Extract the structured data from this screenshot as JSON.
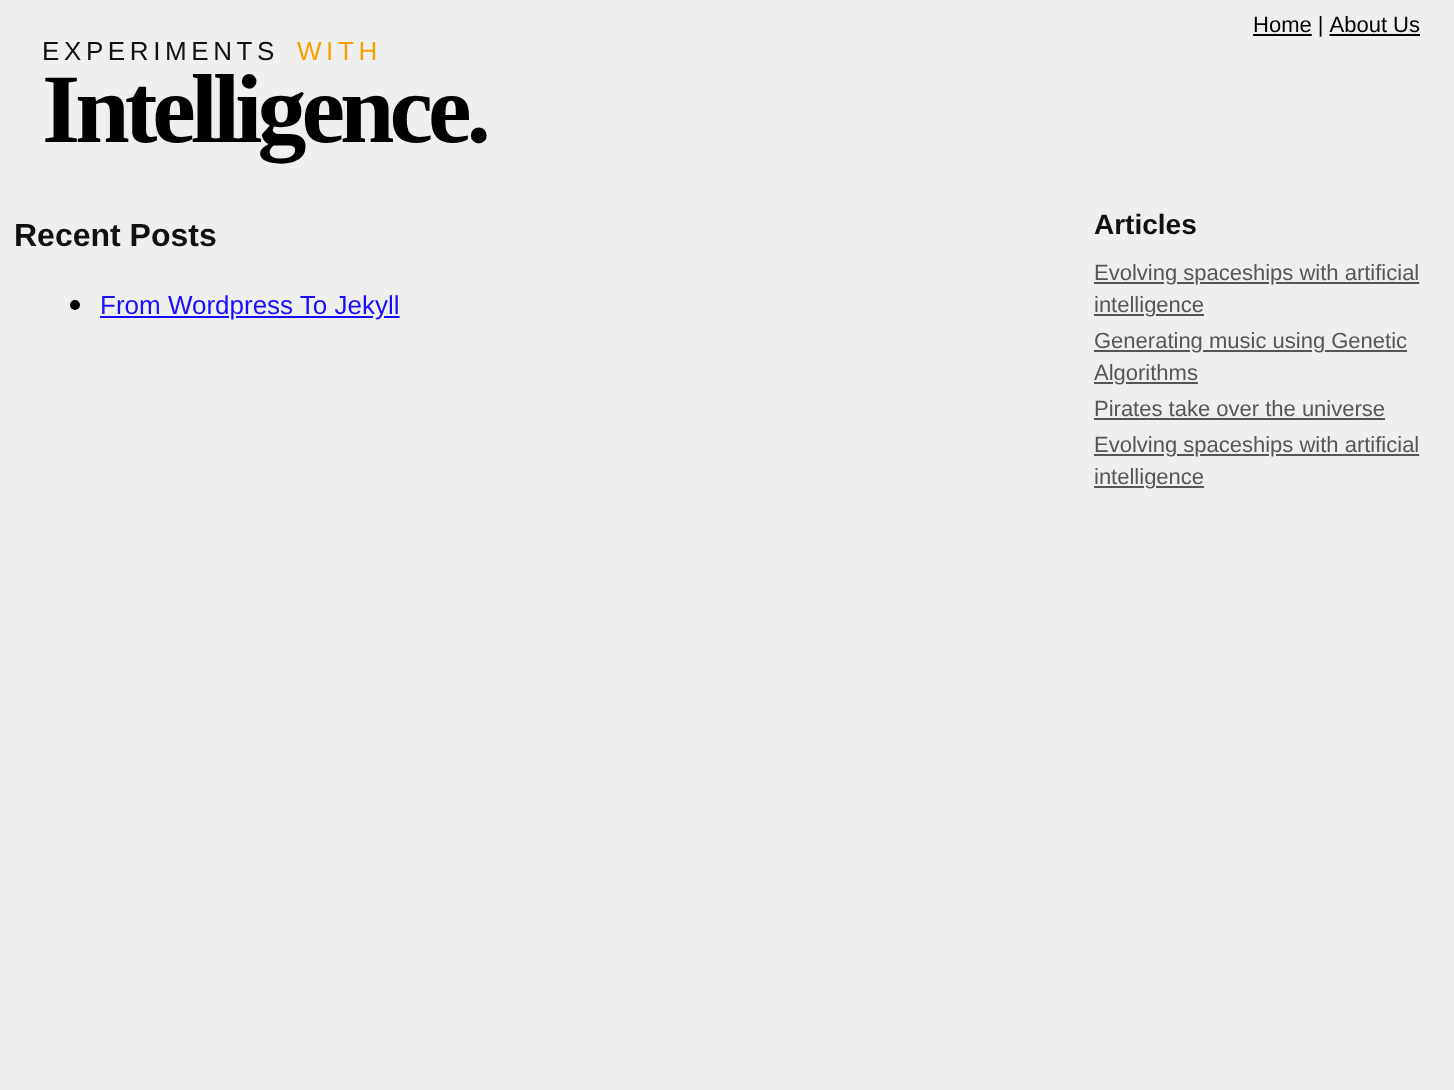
{
  "logo": {
    "tagline": [
      {
        "text": "EXPERIMENTS",
        "color": "#111111"
      },
      {
        "text": "WITH",
        "color": "#f5a000"
      }
    ],
    "title": "Intelligence."
  },
  "nav": [
    "Home",
    "About Us"
  ],
  "nav_separator": "|",
  "recent_posts": {
    "heading": "Recent Posts",
    "items": [
      "From Wordpress To Jekyll"
    ]
  },
  "articles": {
    "heading": "Articles",
    "items": [
      "Evolving spaceships with artificial intelligence",
      "Generating music using Genetic Algorithms",
      "Pirates take over the universe",
      "Evolving spaceships with artificial intelligence"
    ]
  }
}
